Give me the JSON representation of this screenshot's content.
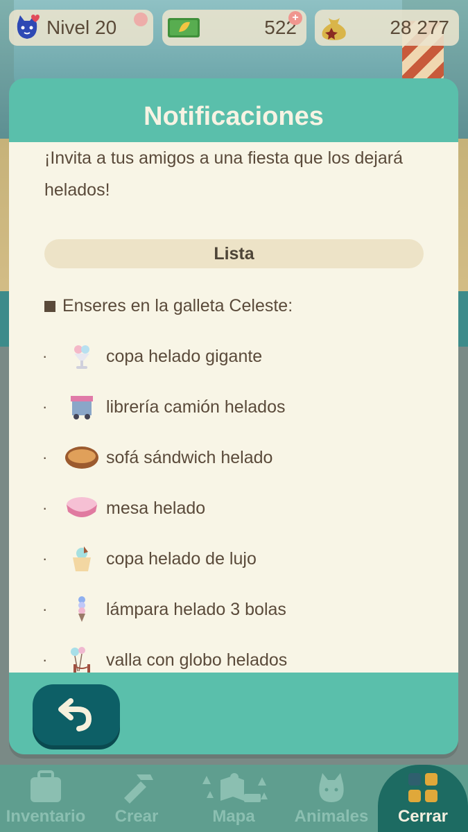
{
  "hud": {
    "level": "Nivel 20",
    "tickets": "522",
    "bells": "28 277",
    "plus": "+"
  },
  "modal": {
    "title": "Notificaciones",
    "intro": "¡Invita a tus amigos a una fiesta que los dejará helados!",
    "list_header": "Lista",
    "section_label": "Enseres en la galleta Celeste:",
    "items": [
      {
        "label": "copa helado gigante",
        "icon": "ice-cream-cup-icon"
      },
      {
        "label": "librería camión helados",
        "icon": "ice-cream-truck-icon"
      },
      {
        "label": "sofá sándwich helado",
        "icon": "sandwich-sofa-icon"
      },
      {
        "label": "mesa helado",
        "icon": "ice-cream-table-icon"
      },
      {
        "label": "copa helado de lujo",
        "icon": "deluxe-cup-icon"
      },
      {
        "label": "lámpara helado 3 bolas",
        "icon": "triple-scoop-lamp-icon"
      },
      {
        "label": "valla con globo helados",
        "icon": "balloon-fence-icon"
      }
    ],
    "bullet": "·"
  },
  "bottom_nav": [
    {
      "label": "Inventario",
      "icon": "inventory-bag-icon"
    },
    {
      "label": "Crear",
      "icon": "craft-hammer-icon"
    },
    {
      "label": "Mapa",
      "icon": "map-icon"
    },
    {
      "label": "Animales",
      "icon": "animal-cat-icon"
    },
    {
      "label": "Cerrar",
      "icon": "close-grid-icon",
      "active": true
    }
  ],
  "colors": {
    "teal": "#5abfab",
    "cream": "#f8f5e6",
    "dark_teal": "#0d5f66",
    "text": "#5a4a3a"
  }
}
